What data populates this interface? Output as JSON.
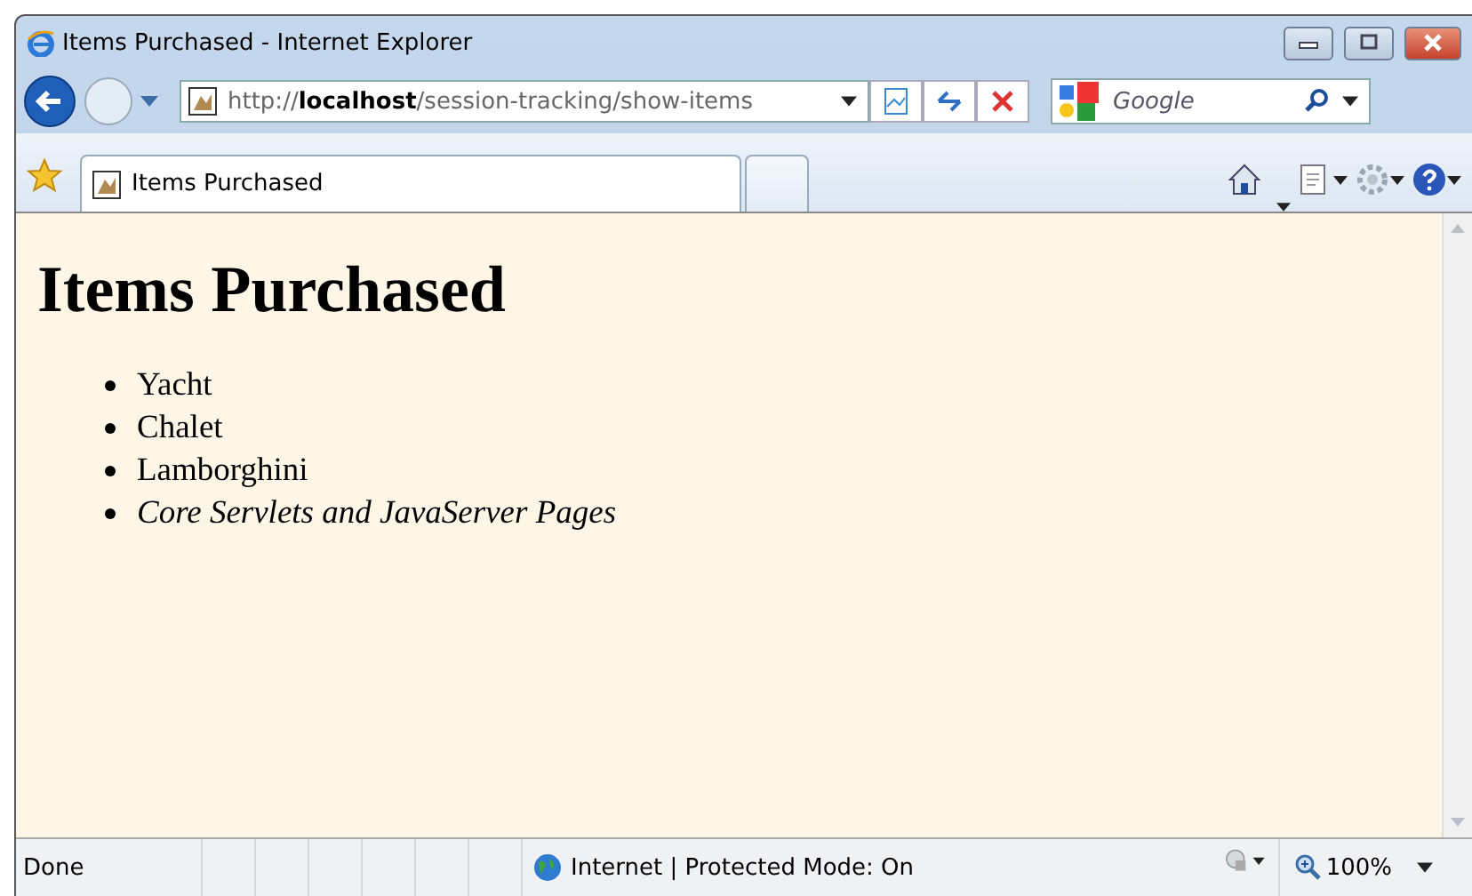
{
  "window": {
    "title": "Items Purchased - Internet Explorer"
  },
  "address_bar": {
    "url": "http://**localhost**/session-tracking/show-items"
  },
  "search": {
    "placeholder": "Google"
  },
  "tabs": [
    {
      "label": "Items Purchased",
      "selected": true
    },
    {
      "selected": false
    }
  ],
  "page": {
    "heading": "Items Purchased",
    "items": [
      {
        "text": "Yacht",
        "italic": false
      },
      {
        "text": "Chalet",
        "italic": false
      },
      {
        "text": "Lamborghini",
        "italic": false
      },
      {
        "text": "Core Servlets and JavaServer Pages",
        "italic": true
      }
    ]
  },
  "status_bar": {
    "status": "Done",
    "zone": "Internet | Protected Mode: On",
    "zoom": "100%"
  }
}
